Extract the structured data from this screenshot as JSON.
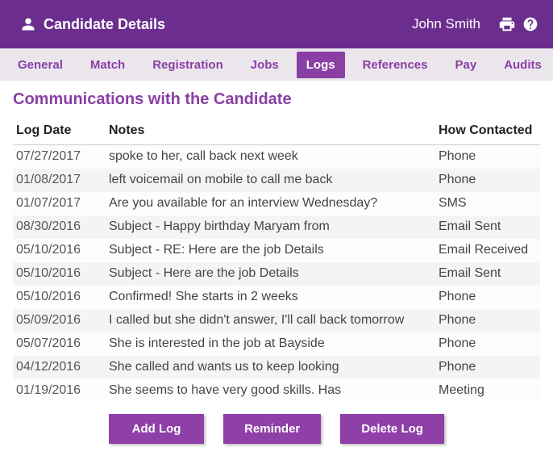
{
  "header": {
    "title": "Candidate Details",
    "username": "John Smith"
  },
  "tabs": [
    {
      "label": "General",
      "active": false
    },
    {
      "label": "Match",
      "active": false
    },
    {
      "label": "Registration",
      "active": false
    },
    {
      "label": "Jobs",
      "active": false
    },
    {
      "label": "Logs",
      "active": true
    },
    {
      "label": "References",
      "active": false
    },
    {
      "label": "Pay",
      "active": false
    },
    {
      "label": "Audits",
      "active": false
    }
  ],
  "section_title": "Communications with the Candidate",
  "columns": {
    "date": "Log Date",
    "notes": "Notes",
    "how": "How Contacted"
  },
  "logs": [
    {
      "date": "07/27/2017",
      "notes": "spoke to her, call back next week",
      "how": "Phone"
    },
    {
      "date": "01/08/2017",
      "notes": "left voicemail on mobile to call me back",
      "how": "Phone"
    },
    {
      "date": "01/07/2017",
      "notes": "Are you available for an interview Wednesday?",
      "how": "SMS"
    },
    {
      "date": "08/30/2016",
      "notes": "Subject - Happy birthday Maryam from",
      "how": "Email Sent"
    },
    {
      "date": "05/10/2016",
      "notes": "Subject - RE: Here are the job Details",
      "how": "Email Received"
    },
    {
      "date": "05/10/2016",
      "notes": "Subject - Here are the job Details",
      "how": "Email Sent"
    },
    {
      "date": "05/10/2016",
      "notes": "Confirmed! She starts in 2 weeks",
      "how": "Phone"
    },
    {
      "date": "05/09/2016",
      "notes": "I called but she didn't answer, I'll call back tomorrow",
      "how": "Phone"
    },
    {
      "date": "05/07/2016",
      "notes": "She is interested in the job at Bayside",
      "how": "Phone"
    },
    {
      "date": "04/12/2016",
      "notes": "She called and wants us to keep looking",
      "how": "Phone"
    },
    {
      "date": "01/19/2016",
      "notes": "She seems to have very good skills. Has",
      "how": "Meeting"
    }
  ],
  "actions": {
    "add": "Add Log",
    "reminder": "Reminder",
    "delete": "Delete Log"
  }
}
